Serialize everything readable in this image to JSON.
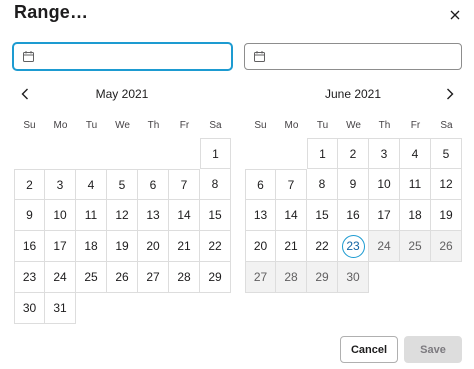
{
  "dialog": {
    "title": "Range…",
    "start_input": {
      "value": "",
      "placeholder": ""
    },
    "end_input": {
      "value": "",
      "placeholder": ""
    },
    "cancel_label": "Cancel",
    "save_label": "Save"
  },
  "weekdays": [
    "Su",
    "Mo",
    "Tu",
    "We",
    "Th",
    "Fr",
    "Sa"
  ],
  "months": [
    {
      "title": "May 2021",
      "lead_blanks": 6,
      "days": [
        "1",
        "2",
        "3",
        "4",
        "5",
        "6",
        "7",
        "8",
        "9",
        "10",
        "11",
        "12",
        "13",
        "14",
        "15",
        "16",
        "17",
        "18",
        "19",
        "20",
        "21",
        "22",
        "23",
        "24",
        "25",
        "26",
        "27",
        "28",
        "29",
        "30",
        "31"
      ],
      "today": null,
      "disabled_from": null
    },
    {
      "title": "June 2021",
      "lead_blanks": 2,
      "days": [
        "1",
        "2",
        "3",
        "4",
        "5",
        "6",
        "7",
        "8",
        "9",
        "10",
        "11",
        "12",
        "13",
        "14",
        "15",
        "16",
        "17",
        "18",
        "19",
        "20",
        "21",
        "22",
        "23",
        "24",
        "25",
        "26",
        "27",
        "28",
        "29",
        "30"
      ],
      "today": "23",
      "disabled_from": "24"
    }
  ],
  "colors": {
    "accent": "#1d9bd1",
    "grid_line": "#dddddd",
    "disabled_bg": "#f2f2f2",
    "save_bg": "#dddddd"
  },
  "icons": {
    "close": "close-icon",
    "calendar": "calendar-icon",
    "prev": "chevron-left-icon",
    "next": "chevron-right-icon"
  }
}
